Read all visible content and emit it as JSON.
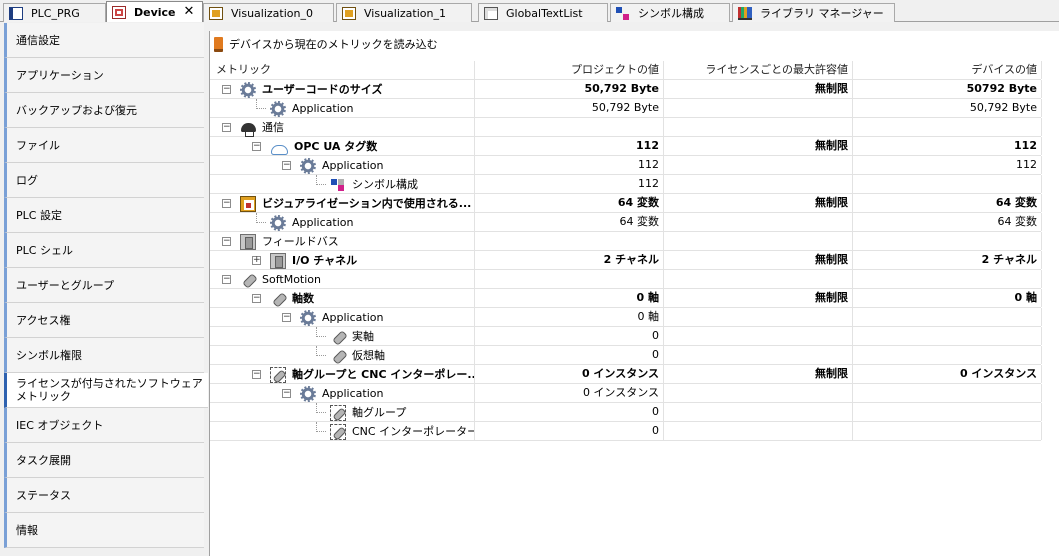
{
  "tabs": [
    {
      "label": "PLC_PRG",
      "icon": "program-icon"
    },
    {
      "label": "Device",
      "icon": "device-icon",
      "active": true,
      "close": "✕"
    },
    {
      "label": "Visualization_0",
      "icon": "visualization-icon"
    },
    {
      "label": "Visualization_1",
      "icon": "visualization-icon"
    },
    {
      "label": "GlobalTextList",
      "icon": "textlist-icon"
    },
    {
      "label": "シンボル構成",
      "icon": "symbol-config-icon"
    },
    {
      "label": "ライブラリ マネージャー",
      "icon": "library-manager-icon"
    }
  ],
  "sidebar": {
    "items": [
      {
        "label": "通信設定"
      },
      {
        "label": "アプリケーション"
      },
      {
        "label": "バックアップおよび復元"
      },
      {
        "label": "ファイル"
      },
      {
        "label": "ログ"
      },
      {
        "label": "PLC 設定"
      },
      {
        "label": "PLC シェル"
      },
      {
        "label": "ユーザーとグループ"
      },
      {
        "label": "アクセス権"
      },
      {
        "label": "シンボル権限"
      },
      {
        "label": "ライセンスが付与されたソフトウェア メトリック",
        "active": true
      },
      {
        "label": "IEC オブジェクト"
      },
      {
        "label": "タスク展開"
      },
      {
        "label": "ステータス"
      },
      {
        "label": "情報"
      }
    ]
  },
  "toolbar": {
    "read_metrics_label": "デバイスから現在のメトリックを読み込む"
  },
  "table": {
    "headers": {
      "metric": "メトリック",
      "project": "プロジェクトの値",
      "license": "ライセンスごとの最大許容値",
      "device": "デバイスの値"
    },
    "rows": [
      {
        "level": 0,
        "exp": "⊟",
        "icon": "gear-icon",
        "label": "ユーザーコードのサイズ",
        "bold": true,
        "project": "50,792 Byte",
        "license": "無制限",
        "device": "50792 Byte"
      },
      {
        "level": 1,
        "icon": "gear-icon",
        "label": "Application",
        "project": "50,792 Byte",
        "license": "",
        "device": "50,792 Byte"
      },
      {
        "level": 0,
        "exp": "⊟",
        "icon": "network-icon",
        "label": "通信",
        "project": "",
        "license": "",
        "device": ""
      },
      {
        "level": 1,
        "exp": "⊟",
        "icon": "cloud-icon",
        "label": "OPC UA タグ数",
        "bold": true,
        "project": "112",
        "license": "無制限",
        "device": "112"
      },
      {
        "level": 2,
        "exp": "⊟",
        "icon": "gear-icon",
        "label": "Application",
        "project": "112",
        "license": "",
        "device": "112"
      },
      {
        "level": 3,
        "icon": "symbol-config-icon",
        "label": "シンボル構成",
        "project": "112",
        "license": "",
        "device": ""
      },
      {
        "level": 0,
        "exp": "⊟",
        "icon": "visualization-icon",
        "label": "ビジュアライゼーション内で使用される...",
        "bold": true,
        "project": "64 変数",
        "license": "無制限",
        "device": "64 変数"
      },
      {
        "level": 1,
        "icon": "gear-icon",
        "label": "Application",
        "project": "64 変数",
        "license": "",
        "device": "64 変数"
      },
      {
        "level": 0,
        "exp": "⊟",
        "icon": "fieldbus-icon",
        "label": "フィールドバス",
        "project": "",
        "license": "",
        "device": ""
      },
      {
        "level": 1,
        "exp": "⊞",
        "icon": "fieldbus-icon",
        "label": "I/O チャネル",
        "bold": true,
        "project": "2 チャネル",
        "license": "無制限",
        "device": "2 チャネル"
      },
      {
        "level": 0,
        "exp": "⊟",
        "icon": "axis-icon",
        "label": "SoftMotion",
        "project": "",
        "license": "",
        "device": ""
      },
      {
        "level": 1,
        "exp": "⊟",
        "icon": "axis-icon",
        "label": "軸数",
        "bold": true,
        "project": "0 軸",
        "license": "無制限",
        "device": "0 軸"
      },
      {
        "level": 2,
        "exp": "⊟",
        "icon": "gear-icon",
        "label": "Application",
        "project": "0 軸",
        "license": "",
        "device": ""
      },
      {
        "level": 3,
        "icon": "axis-icon",
        "label": "実軸",
        "project": "0",
        "license": "",
        "device": ""
      },
      {
        "level": 3,
        "icon": "axis-icon",
        "label": "仮想軸",
        "project": "0",
        "license": "",
        "device": ""
      },
      {
        "level": 1,
        "exp": "⊟",
        "icon": "axis-group-icon",
        "label": "軸グループと CNC インターポレー...",
        "bold": true,
        "project": "0 インスタンス",
        "license": "無制限",
        "device": "0 インスタンス"
      },
      {
        "level": 2,
        "exp": "⊟",
        "icon": "gear-icon",
        "label": "Application",
        "project": "0 インスタンス",
        "license": "",
        "device": ""
      },
      {
        "level": 3,
        "icon": "axis-group-icon",
        "label": "軸グループ",
        "project": "0",
        "license": "",
        "device": ""
      },
      {
        "level": 3,
        "icon": "axis-group-icon",
        "label": "CNC インターポレーター",
        "project": "0",
        "license": "",
        "device": ""
      }
    ]
  }
}
